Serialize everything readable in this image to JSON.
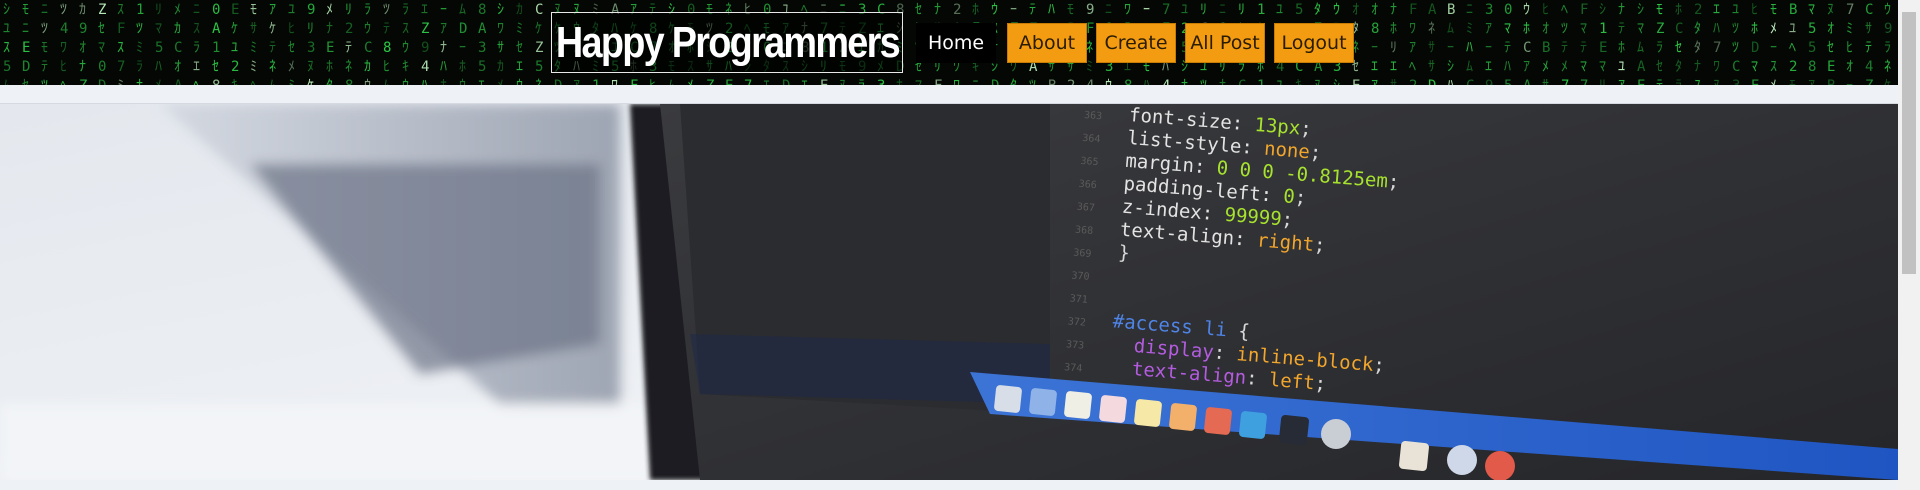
{
  "header": {
    "brand": "Happy Programmers",
    "nav": [
      {
        "label": "Home"
      },
      {
        "label": "About"
      },
      {
        "label": "Create"
      },
      {
        "label": "All Post"
      },
      {
        "label": "Logout"
      }
    ]
  },
  "hero": {
    "code_lines": [
      {
        "parts": [
          {
            "t": "font-size: ",
            "c": "c-prop"
          },
          {
            "t": "13px",
            "c": "c-num"
          },
          {
            "t": ";",
            "c": "c-punct"
          }
        ]
      },
      {
        "parts": [
          {
            "t": "list-style: ",
            "c": "c-prop"
          },
          {
            "t": "none",
            "c": "c-val"
          },
          {
            "t": ";",
            "c": "c-punct"
          }
        ]
      },
      {
        "parts": [
          {
            "t": "margin: ",
            "c": "c-prop"
          },
          {
            "t": "0 0 0 -0.8125em",
            "c": "c-num"
          },
          {
            "t": ";",
            "c": "c-punct"
          }
        ]
      },
      {
        "parts": [
          {
            "t": "padding-left: ",
            "c": "c-prop"
          },
          {
            "t": "0",
            "c": "c-num"
          },
          {
            "t": ";",
            "c": "c-punct"
          }
        ]
      },
      {
        "parts": [
          {
            "t": "z-index: ",
            "c": "c-prop"
          },
          {
            "t": "99999",
            "c": "c-num"
          },
          {
            "t": ";",
            "c": "c-punct"
          }
        ]
      },
      {
        "parts": [
          {
            "t": "text-align: ",
            "c": "c-prop"
          },
          {
            "t": "right",
            "c": "c-val"
          },
          {
            "t": ";",
            "c": "c-punct"
          }
        ]
      },
      {
        "parts": [
          {
            "t": "}",
            "c": "c-punct"
          }
        ]
      },
      {
        "parts": []
      },
      {
        "parts": []
      },
      {
        "parts": [
          {
            "t": "#access li ",
            "c": "c-sel"
          },
          {
            "t": "{",
            "c": "c-punct"
          }
        ]
      },
      {
        "parts": [
          {
            "t": "  display",
            "c": "c-prop2"
          },
          {
            "t": ": ",
            "c": "c-punct"
          },
          {
            "t": "inline-block",
            "c": "c-val"
          },
          {
            "t": ";",
            "c": "c-punct"
          }
        ]
      },
      {
        "parts": [
          {
            "t": "  text-align",
            "c": "c-prop2"
          },
          {
            "t": ": ",
            "c": "c-punct"
          },
          {
            "t": "left",
            "c": "c-val"
          },
          {
            "t": ";",
            "c": "c-punct"
          }
        ]
      }
    ]
  },
  "colors": {
    "nav_accent": "#f39c12",
    "header_bg": "#040704",
    "matrix_green": "#2fd24a"
  }
}
